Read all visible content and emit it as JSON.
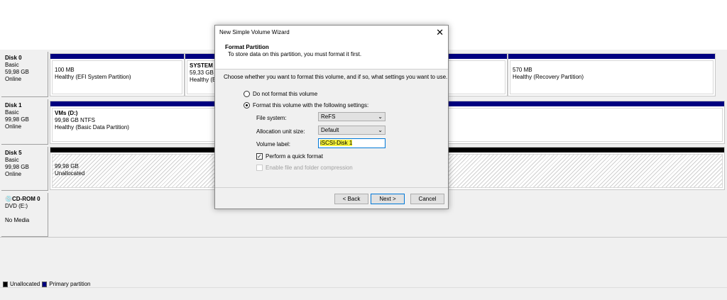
{
  "disks": [
    {
      "name": "Disk 0",
      "type": "Basic",
      "size": "59,98 GB",
      "status": "Online",
      "partitions": [
        {
          "title": "",
          "size": "100 MB",
          "status": "Healthy (EFI System Partition)"
        },
        {
          "title": "SYSTEM (",
          "size": "59,33 GB N",
          "status": "Healthy (B"
        },
        {
          "title": "",
          "size": "",
          "status": ""
        },
        {
          "title": "",
          "size": "570 MB",
          "status": "Healthy (Recovery Partition)"
        }
      ]
    },
    {
      "name": "Disk 1",
      "type": "Basic",
      "size": "99,98 GB",
      "status": "Online",
      "partitions": [
        {
          "title": "VMs  (D:)",
          "size": "99,98 GB NTFS",
          "status": "Healthy (Basic Data Partition)"
        }
      ]
    },
    {
      "name": "Disk 5",
      "type": "Basic",
      "size": "99,98 GB",
      "status": "Online",
      "partitions": [
        {
          "title": "",
          "size": "99,98 GB",
          "status": "Unallocated"
        }
      ]
    },
    {
      "name": "CD-ROM 0",
      "type": "DVD (E:)",
      "size": "",
      "status": "No Media"
    }
  ],
  "legend": {
    "unallocated": "Unallocated",
    "primary": "Primary partition"
  },
  "dialog": {
    "title": "New Simple Volume Wizard",
    "heading": "Format Partition",
    "subheading": "To store data on this partition, you must format it first.",
    "instruction": "Choose whether you want to format this volume, and if so, what settings you want to use.",
    "opt_no_format": "Do not format this volume",
    "opt_format": "Format this volume with the following settings:",
    "file_system_label": "File system:",
    "file_system_value": "ReFS",
    "alloc_label": "Allocation unit size:",
    "alloc_value": "Default",
    "volume_label_label": "Volume label:",
    "volume_label_value": "iSCSI-Disk 1",
    "quick_format": "Perform a quick format",
    "compression": "Enable file and folder compression",
    "back": "< Back",
    "next": "Next >",
    "cancel": "Cancel"
  },
  "colors": {
    "primary": "#000080",
    "unallocated": "#000000",
    "highlight": "#f5f33a"
  }
}
